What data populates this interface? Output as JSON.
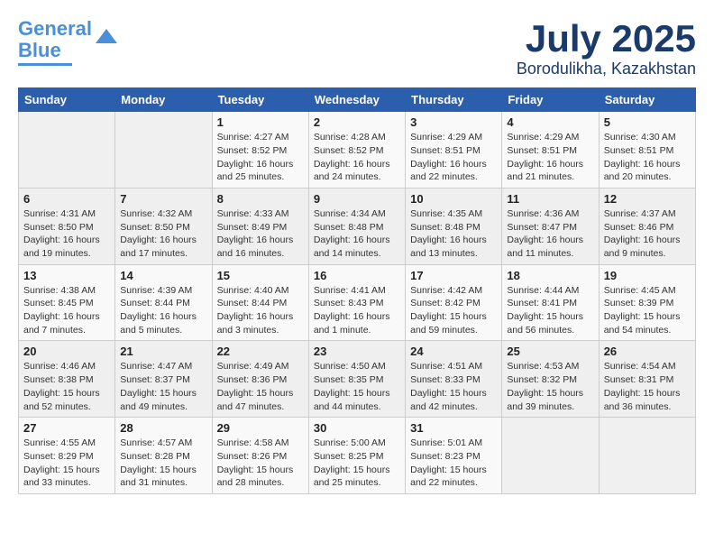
{
  "logo": {
    "line1": "General",
    "line2": "Blue"
  },
  "title": "July 2025",
  "subtitle": "Borodulikha, Kazakhstan",
  "weekdays": [
    "Sunday",
    "Monday",
    "Tuesday",
    "Wednesday",
    "Thursday",
    "Friday",
    "Saturday"
  ],
  "weeks": [
    [
      {
        "day": "",
        "info": ""
      },
      {
        "day": "",
        "info": ""
      },
      {
        "day": "1",
        "info": "Sunrise: 4:27 AM\nSunset: 8:52 PM\nDaylight: 16 hours\nand 25 minutes."
      },
      {
        "day": "2",
        "info": "Sunrise: 4:28 AM\nSunset: 8:52 PM\nDaylight: 16 hours\nand 24 minutes."
      },
      {
        "day": "3",
        "info": "Sunrise: 4:29 AM\nSunset: 8:51 PM\nDaylight: 16 hours\nand 22 minutes."
      },
      {
        "day": "4",
        "info": "Sunrise: 4:29 AM\nSunset: 8:51 PM\nDaylight: 16 hours\nand 21 minutes."
      },
      {
        "day": "5",
        "info": "Sunrise: 4:30 AM\nSunset: 8:51 PM\nDaylight: 16 hours\nand 20 minutes."
      }
    ],
    [
      {
        "day": "6",
        "info": "Sunrise: 4:31 AM\nSunset: 8:50 PM\nDaylight: 16 hours\nand 19 minutes."
      },
      {
        "day": "7",
        "info": "Sunrise: 4:32 AM\nSunset: 8:50 PM\nDaylight: 16 hours\nand 17 minutes."
      },
      {
        "day": "8",
        "info": "Sunrise: 4:33 AM\nSunset: 8:49 PM\nDaylight: 16 hours\nand 16 minutes."
      },
      {
        "day": "9",
        "info": "Sunrise: 4:34 AM\nSunset: 8:48 PM\nDaylight: 16 hours\nand 14 minutes."
      },
      {
        "day": "10",
        "info": "Sunrise: 4:35 AM\nSunset: 8:48 PM\nDaylight: 16 hours\nand 13 minutes."
      },
      {
        "day": "11",
        "info": "Sunrise: 4:36 AM\nSunset: 8:47 PM\nDaylight: 16 hours\nand 11 minutes."
      },
      {
        "day": "12",
        "info": "Sunrise: 4:37 AM\nSunset: 8:46 PM\nDaylight: 16 hours\nand 9 minutes."
      }
    ],
    [
      {
        "day": "13",
        "info": "Sunrise: 4:38 AM\nSunset: 8:45 PM\nDaylight: 16 hours\nand 7 minutes."
      },
      {
        "day": "14",
        "info": "Sunrise: 4:39 AM\nSunset: 8:44 PM\nDaylight: 16 hours\nand 5 minutes."
      },
      {
        "day": "15",
        "info": "Sunrise: 4:40 AM\nSunset: 8:44 PM\nDaylight: 16 hours\nand 3 minutes."
      },
      {
        "day": "16",
        "info": "Sunrise: 4:41 AM\nSunset: 8:43 PM\nDaylight: 16 hours\nand 1 minute."
      },
      {
        "day": "17",
        "info": "Sunrise: 4:42 AM\nSunset: 8:42 PM\nDaylight: 15 hours\nand 59 minutes."
      },
      {
        "day": "18",
        "info": "Sunrise: 4:44 AM\nSunset: 8:41 PM\nDaylight: 15 hours\nand 56 minutes."
      },
      {
        "day": "19",
        "info": "Sunrise: 4:45 AM\nSunset: 8:39 PM\nDaylight: 15 hours\nand 54 minutes."
      }
    ],
    [
      {
        "day": "20",
        "info": "Sunrise: 4:46 AM\nSunset: 8:38 PM\nDaylight: 15 hours\nand 52 minutes."
      },
      {
        "day": "21",
        "info": "Sunrise: 4:47 AM\nSunset: 8:37 PM\nDaylight: 15 hours\nand 49 minutes."
      },
      {
        "day": "22",
        "info": "Sunrise: 4:49 AM\nSunset: 8:36 PM\nDaylight: 15 hours\nand 47 minutes."
      },
      {
        "day": "23",
        "info": "Sunrise: 4:50 AM\nSunset: 8:35 PM\nDaylight: 15 hours\nand 44 minutes."
      },
      {
        "day": "24",
        "info": "Sunrise: 4:51 AM\nSunset: 8:33 PM\nDaylight: 15 hours\nand 42 minutes."
      },
      {
        "day": "25",
        "info": "Sunrise: 4:53 AM\nSunset: 8:32 PM\nDaylight: 15 hours\nand 39 minutes."
      },
      {
        "day": "26",
        "info": "Sunrise: 4:54 AM\nSunset: 8:31 PM\nDaylight: 15 hours\nand 36 minutes."
      }
    ],
    [
      {
        "day": "27",
        "info": "Sunrise: 4:55 AM\nSunset: 8:29 PM\nDaylight: 15 hours\nand 33 minutes."
      },
      {
        "day": "28",
        "info": "Sunrise: 4:57 AM\nSunset: 8:28 PM\nDaylight: 15 hours\nand 31 minutes."
      },
      {
        "day": "29",
        "info": "Sunrise: 4:58 AM\nSunset: 8:26 PM\nDaylight: 15 hours\nand 28 minutes."
      },
      {
        "day": "30",
        "info": "Sunrise: 5:00 AM\nSunset: 8:25 PM\nDaylight: 15 hours\nand 25 minutes."
      },
      {
        "day": "31",
        "info": "Sunrise: 5:01 AM\nSunset: 8:23 PM\nDaylight: 15 hours\nand 22 minutes."
      },
      {
        "day": "",
        "info": ""
      },
      {
        "day": "",
        "info": ""
      }
    ]
  ]
}
